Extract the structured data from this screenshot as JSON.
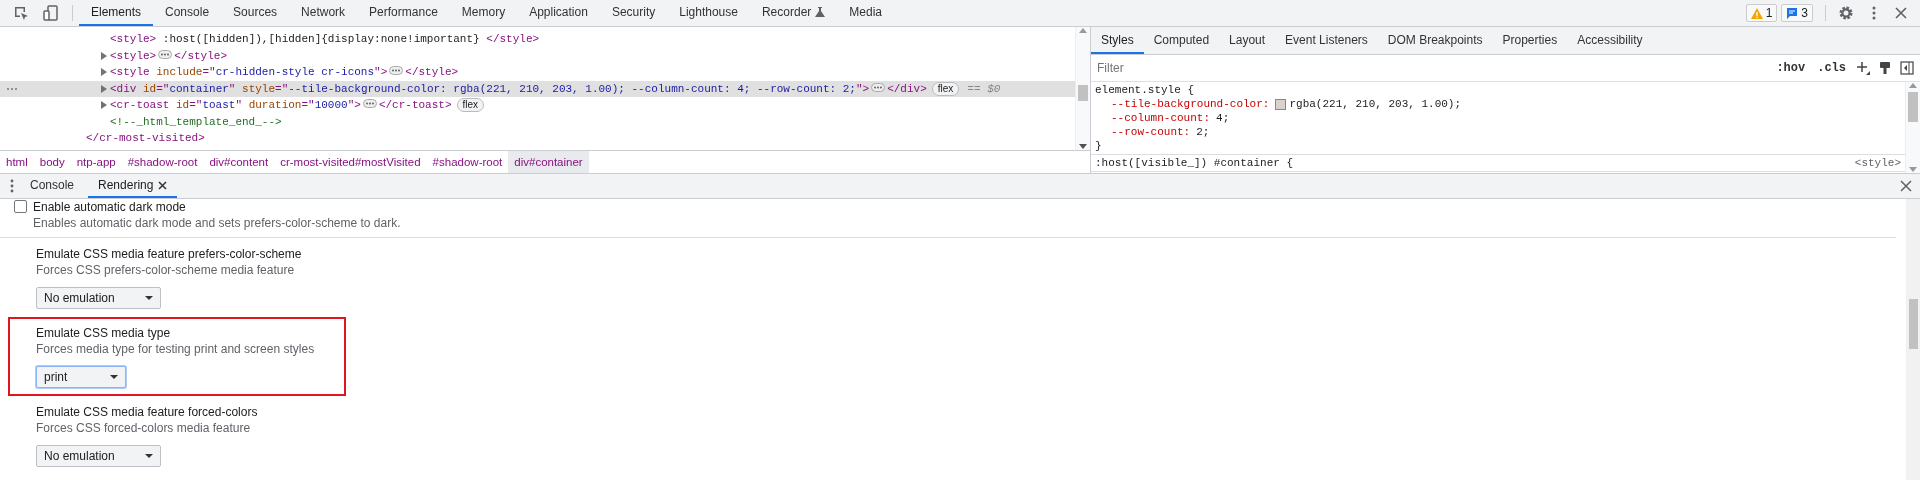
{
  "toolbar": {
    "tabs": [
      {
        "label": "Elements",
        "selected": true
      },
      {
        "label": "Console",
        "selected": false
      },
      {
        "label": "Sources",
        "selected": false
      },
      {
        "label": "Network",
        "selected": false
      },
      {
        "label": "Performance",
        "selected": false
      },
      {
        "label": "Memory",
        "selected": false
      },
      {
        "label": "Application",
        "selected": false
      },
      {
        "label": "Security",
        "selected": false
      },
      {
        "label": "Lighthouse",
        "selected": false
      },
      {
        "label": "Recorder",
        "selected": false,
        "experimental": true
      },
      {
        "label": "Media",
        "selected": false
      }
    ],
    "warnings": "1",
    "messages": "3"
  },
  "dom": {
    "children": [
      {
        "toggle": false,
        "selected": false,
        "segments": [
          {
            "kind": "tag",
            "t": "<style>"
          },
          {
            "kind": "text",
            "t": " :host([hidden]),[hidden]{display:none!important} "
          },
          {
            "kind": "tag",
            "t": "</style>"
          }
        ]
      },
      {
        "toggle": true,
        "selected": false,
        "segments": [
          {
            "kind": "tag",
            "t": "<style>"
          },
          {
            "kind": "ellipsis"
          },
          {
            "kind": "tag",
            "t": "</style>"
          }
        ]
      },
      {
        "toggle": true,
        "selected": false,
        "segments": [
          {
            "kind": "tag",
            "t": "<style "
          },
          {
            "kind": "attr",
            "t": "include"
          },
          {
            "kind": "tag",
            "t": "=\""
          },
          {
            "kind": "value",
            "t": "cr-hidden-style cr-icons"
          },
          {
            "kind": "tag",
            "t": "\">"
          },
          {
            "kind": "ellipsis"
          },
          {
            "kind": "tag",
            "t": "</style>"
          }
        ]
      },
      {
        "toggle": true,
        "selected": true,
        "segments": [
          {
            "kind": "tag",
            "t": "<div "
          },
          {
            "kind": "attr",
            "t": "id"
          },
          {
            "kind": "tag",
            "t": "=\""
          },
          {
            "kind": "value",
            "t": "container"
          },
          {
            "kind": "tag",
            "t": "\" "
          },
          {
            "kind": "attr",
            "t": "style"
          },
          {
            "kind": "tag",
            "t": "=\""
          },
          {
            "kind": "value",
            "t": "--tile-background-color: rgba(221, 210, 203, 1.00); --column-count: 4; --row-count: 2;"
          },
          {
            "kind": "tag",
            "t": "\">"
          },
          {
            "kind": "ellipsis"
          },
          {
            "kind": "tag",
            "t": "</div>"
          },
          {
            "kind": "badge",
            "t": "flex"
          },
          {
            "kind": "ref",
            "t": "== $0"
          }
        ]
      },
      {
        "toggle": true,
        "selected": false,
        "segments": [
          {
            "kind": "tag",
            "t": "<cr-toast "
          },
          {
            "kind": "attr",
            "t": "id"
          },
          {
            "kind": "tag",
            "t": "=\""
          },
          {
            "kind": "value",
            "t": "toast"
          },
          {
            "kind": "tag",
            "t": "\" "
          },
          {
            "kind": "attr",
            "t": "duration"
          },
          {
            "kind": "tag",
            "t": "=\""
          },
          {
            "kind": "value",
            "t": "10000"
          },
          {
            "kind": "tag",
            "t": "\">"
          },
          {
            "kind": "ellipsis"
          },
          {
            "kind": "tag",
            "t": "</cr-toast>"
          },
          {
            "kind": "badge",
            "t": "flex"
          }
        ]
      },
      {
        "toggle": false,
        "selected": false,
        "segments": [
          {
            "kind": "comment",
            "t": "<!--_html_template_end_-->"
          }
        ]
      }
    ],
    "closing_tag": "</cr-most-visited>"
  },
  "breadcrumbs": [
    {
      "label": "html",
      "selected": false
    },
    {
      "label": "body",
      "selected": false
    },
    {
      "label": "ntp-app",
      "selected": false
    },
    {
      "label": "#shadow-root",
      "selected": false
    },
    {
      "label": "div#content",
      "selected": false
    },
    {
      "label": "cr-most-visited#mostVisited",
      "selected": false
    },
    {
      "label": "#shadow-root",
      "selected": false
    },
    {
      "label": "div#container",
      "selected": true
    }
  ],
  "styles": {
    "tabs": [
      {
        "label": "Styles",
        "selected": true
      },
      {
        "label": "Computed",
        "selected": false
      },
      {
        "label": "Layout",
        "selected": false
      },
      {
        "label": "Event Listeners",
        "selected": false
      },
      {
        "label": "DOM Breakpoints",
        "selected": false
      },
      {
        "label": "Properties",
        "selected": false
      },
      {
        "label": "Accessibility",
        "selected": false
      }
    ],
    "filter": {
      "placeholder": "Filter"
    },
    "hov": ":hov",
    "cls": ".cls",
    "rules": [
      {
        "selector": "element.style {",
        "declarations": [
          {
            "name": "--tile-background-color:",
            "value": "rgba(221, 210, 203, 1.00);",
            "color": "#ddd2cb"
          },
          {
            "name": "--column-count:",
            "value": "4;"
          },
          {
            "name": "--row-count:",
            "value": "2;"
          }
        ],
        "close": "}"
      },
      {
        "selector": ":host([visible_]) #container {",
        "source": "<style>"
      }
    ]
  },
  "drawer": {
    "tabs": [
      {
        "label": "Console",
        "selected": false,
        "closable": false
      },
      {
        "label": "Rendering",
        "selected": true,
        "closable": true
      }
    ],
    "items": [
      {
        "kind": "checkbox",
        "title": "Enable automatic dark mode",
        "description": "Enables automatic dark mode and sets prefers-color-scheme to dark.",
        "checked": false
      },
      {
        "kind": "select",
        "title": "Emulate CSS media feature prefers-color-scheme",
        "description": "Forces CSS prefers-color-scheme media feature",
        "value": "No emulation",
        "focused": false,
        "highlighted": false
      },
      {
        "kind": "select",
        "title": "Emulate CSS media type",
        "description": "Forces media type for testing print and screen styles",
        "value": "print",
        "focused": true,
        "highlighted": true
      },
      {
        "kind": "select",
        "title": "Emulate CSS media feature forced-colors",
        "description": "Forces CSS forced-colors media feature",
        "value": "No emulation",
        "focused": false,
        "highlighted": false
      }
    ]
  }
}
